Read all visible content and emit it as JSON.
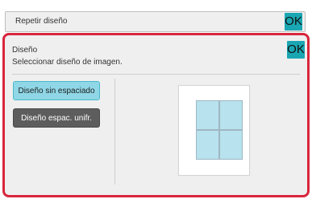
{
  "top_bar": {
    "title": "Repetir diseño",
    "ok_label": "OK"
  },
  "dialog": {
    "title": "Diseño",
    "subtitle": "Seleccionar diseño de imagen.",
    "ok_label": "OK",
    "options": [
      {
        "label": "Diseño sin espaciado",
        "selected": true
      },
      {
        "label": "Diseño espac. unifr.",
        "selected": false
      }
    ]
  },
  "colors": {
    "accent": "#1aa6b2",
    "highlight_border": "#d8263d",
    "selected_option": "#8fd7e6",
    "normal_option": "#5d5d5d"
  }
}
